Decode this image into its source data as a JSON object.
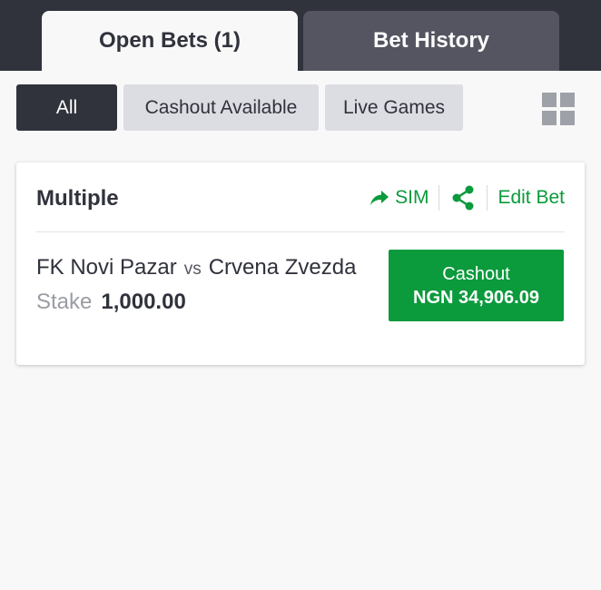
{
  "tabs": {
    "open_bets": "Open Bets (1)",
    "bet_history": "Bet History"
  },
  "filters": {
    "all": "All",
    "cashout_available": "Cashout Available",
    "live_games": "Live Games",
    "layout_icon": "grid-icon"
  },
  "bet": {
    "type": "Multiple",
    "actions": {
      "sim": "SIM",
      "share_icon": "share-icon",
      "edit": "Edit Bet"
    },
    "home_team": "FK Novi Pazar",
    "vs": "vs",
    "away_team": "Crvena Zvezda",
    "stake_label": "Stake",
    "stake_amount": "1,000.00",
    "cashout_label": "Cashout",
    "cashout_amount": "NGN 34,906.09"
  },
  "colors": {
    "header_bg": "#30323c",
    "accent_green": "#0b9a3c",
    "chip_bg": "#dcdde3"
  }
}
